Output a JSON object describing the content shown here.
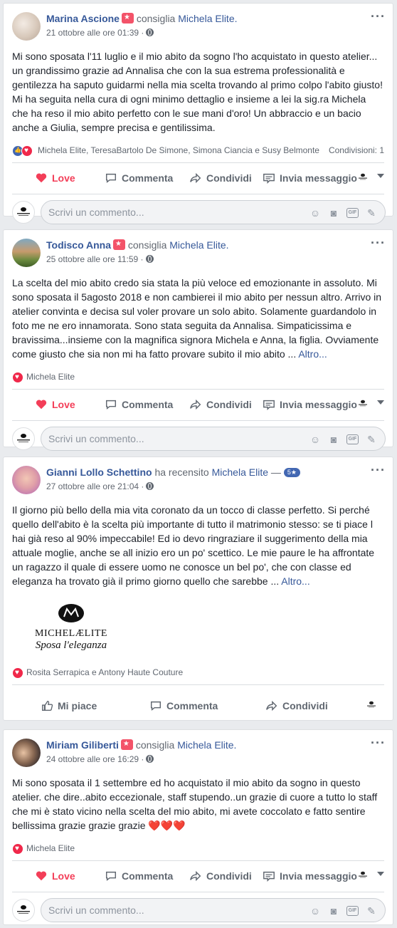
{
  "common": {
    "comment_placeholder": "Scrivi un commento...",
    "love": "Love",
    "comment": "Commenta",
    "share": "Condividi",
    "message": "Invia messaggio",
    "like": "Mi piace",
    "more": "Altro..."
  },
  "brand": {
    "name": "MICHELÆLITE",
    "tagline": "Sposa l'eleganza"
  },
  "posts": [
    {
      "author": "Marina Ascione",
      "verb": "consiglia",
      "page": "Michela Elite.",
      "date": "21 ottobre alle ore 01:39 ·",
      "text": "Mi sono sposata l'11 luglio e il mio abito da sogno l'ho acquistato in questo atelier... un grandissimo grazie ad Annalisa che con la sua estrema professionalità e gentilezza ha saputo guidarmi nella mia scelta trovando al primo colpo l'abito giusto! Mi ha seguita nella cura di ogni minimo dettaglio e insieme a lei la sig.ra Michela che ha reso il mio abito perfetto con le sue mani d'oro! Un abbraccio e un bacio anche a Giulia, sempre precisa e gentilissima.",
      "reactions": "Michela Elite, TeresaBartolo De Simone, Simona Ciancia e Susy Belmonte",
      "shares": "Condivisioni: 1"
    },
    {
      "author": "Todisco Anna",
      "verb": "consiglia",
      "page": "Michela Elite.",
      "date": "25 ottobre alle ore 11:59 ·",
      "text": "La scelta del mio abito credo sia stata la più veloce ed emozionante in assoluto. Mi sono sposata il 5agosto 2018 e non cambierei il mio abito per nessun altro. Arrivo in atelier convinta e decisa sul voler provare un solo abito. Solamente guardandolo in foto me ne ero innamorata. Sono stata seguita da Annalisa. Simpaticissima e bravissima...insieme con la magnifica signora Michela e Anna, la figlia. Ovviamente come giusto che sia non mi ha fatto provare subito il mio abito ...",
      "reactions": "Michela Elite"
    },
    {
      "author": "Gianni Lollo Schettino",
      "verb": "ha recensito",
      "page": "Michela Elite",
      "dash": "—",
      "stars": "5★",
      "date": "27 ottobre alle ore 21:04 ·",
      "text": "Il giorno più bello della mia vita coronato da un tocco di classe perfetto. Si perché quello dell'abito è la scelta più importante di tutto il matrimonio stesso: se ti piace l hai già reso al 90% impeccabile! Ed io devo ringraziare il suggerimento della mia attuale moglie, anche se all inizio ero un po' scettico. Le mie paure le ha affrontate un ragazzo il quale di essere uomo ne conosce un bel po', che con classe ed eleganza ha trovato già il primo giorno quello che sarebbe ...",
      "reactions": "Rosita Serrapica e Antony Haute Couture"
    },
    {
      "author": "Miriam Giliberti",
      "verb": "consiglia",
      "page": "Michela Elite.",
      "date": "24 ottobre alle ore 16:29 ·",
      "text": "Mi sono sposata il 1 settembre ed ho acquistato il mio abito da sogno in questo atelier. che dire..abito eccezionale, staff stupendo..un grazie di cuore a tutto lo staff che mi è stato vicino nella scelta del mio abito, mi avete coccolato e fatto sentire bellissima grazie grazie grazie",
      "hearts": "❤️❤️❤️",
      "reactions": "Michela Elite"
    }
  ],
  "colors": {
    "link": "#365899",
    "love": "#f33e58",
    "like": "#4267b2",
    "muted": "#606770"
  }
}
